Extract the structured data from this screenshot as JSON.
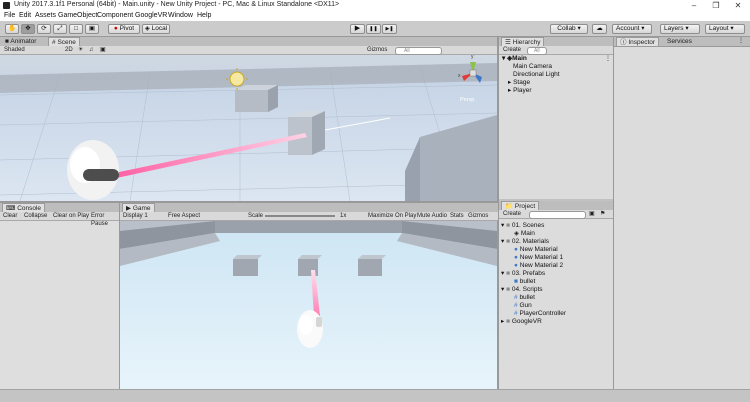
{
  "window": {
    "title": "Unity 2017.3.1f1 Personal (64bit) - Main.unity - New Unity Project - PC, Mac & Linux Standalone <DX11>",
    "controls": [
      "–",
      "❐",
      "✕"
    ]
  },
  "menu": [
    "File",
    "Edit",
    "Assets",
    "GameObject",
    "Component",
    "GoogleVR",
    "Window",
    "Help"
  ],
  "toolbar": {
    "tools": [
      "hand-tool",
      "move-tool",
      "rotate-tool",
      "scale-tool",
      "rect-tool",
      "transform-tool"
    ],
    "pivot_label": "Pivot",
    "local_label": "Local",
    "play": "▶",
    "pause": "❚❚",
    "step": "▶❚",
    "collab_label": "Collab ▾",
    "account_label": "Account",
    "layers_label": "Layers",
    "layout_label": "Layout"
  },
  "scene_panel": {
    "tabs": [
      "Animator",
      "Scene"
    ],
    "shading": "Shaded",
    "mode_2d": "2D",
    "gizmos": "Gizmos",
    "search_placeholder": "All",
    "persp_label": "Persp",
    "axis_x": "x",
    "axis_y": "y"
  },
  "hierarchy": {
    "tab": "Hierarchy",
    "create_label": "Create",
    "search_placeholder": "All",
    "scene_name": "Main",
    "items": [
      "Main Camera",
      "Directional Light",
      "Stage",
      "Player"
    ]
  },
  "inspector": {
    "tabs": [
      "Inspector",
      "Services"
    ]
  },
  "console": {
    "tab": "Console",
    "buttons": [
      "Clear",
      "Collapse",
      "Clear on Play",
      "Error Pause"
    ]
  },
  "game_panel": {
    "tab": "Game",
    "display": "Display 1",
    "aspect": "Free Aspect",
    "scale_label": "Scale",
    "scale_value": "1x",
    "options": [
      "Maximize On Play",
      "Mute Audio",
      "Stats",
      "Gizmos"
    ]
  },
  "project": {
    "tab": "Project",
    "create_label": "Create",
    "folders": [
      {
        "name": "01. Scenes",
        "children": [
          "Main"
        ]
      },
      {
        "name": "02. Materials",
        "children": [
          "New Material",
          "New Material 1",
          "New Material 2"
        ]
      },
      {
        "name": "03. Prefabs",
        "children": [
          "bullet"
        ]
      },
      {
        "name": "04. Scripts",
        "children": [
          "bullet",
          "Gun",
          "PlayerController"
        ]
      },
      {
        "name": "GoogleVR",
        "children": []
      }
    ]
  },
  "colors": {
    "accent_blue": "#3b78c9",
    "laser": "#ff6fa8",
    "toolbar_bg": "#cbcbcb",
    "panel_bg": "#dcdcdc"
  }
}
